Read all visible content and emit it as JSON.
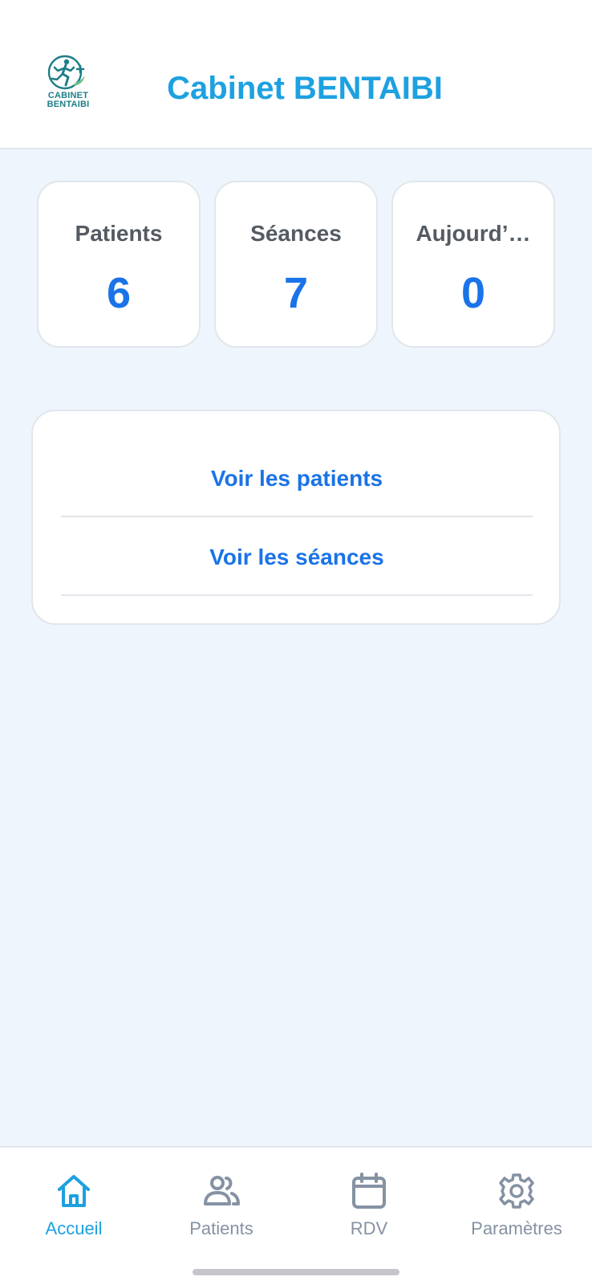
{
  "header": {
    "logo_text_line1": "CABINET",
    "logo_text_line2": "BENTAIBI",
    "title": "Cabinet BENTAIBI"
  },
  "stats": [
    {
      "label": "Patients",
      "value": "6"
    },
    {
      "label": "Séances",
      "value": "7"
    },
    {
      "label": "Aujourd’…",
      "value": "0"
    }
  ],
  "actions": {
    "view_patients": "Voir les patients",
    "view_sessions": "Voir les séances"
  },
  "bottom_nav": {
    "items": [
      {
        "label": "Accueil",
        "icon": "home-icon",
        "active": true
      },
      {
        "label": "Patients",
        "icon": "users-icon",
        "active": false
      },
      {
        "label": "RDV",
        "icon": "calendar-icon",
        "active": false
      },
      {
        "label": "Paramètres",
        "icon": "gear-icon",
        "active": false
      }
    ]
  },
  "colors": {
    "accent": "#1DA1E0",
    "primary": "#1A73E8",
    "background": "#EEF5FD",
    "inactive": "#8592A3",
    "logo": "#1E7E86"
  }
}
